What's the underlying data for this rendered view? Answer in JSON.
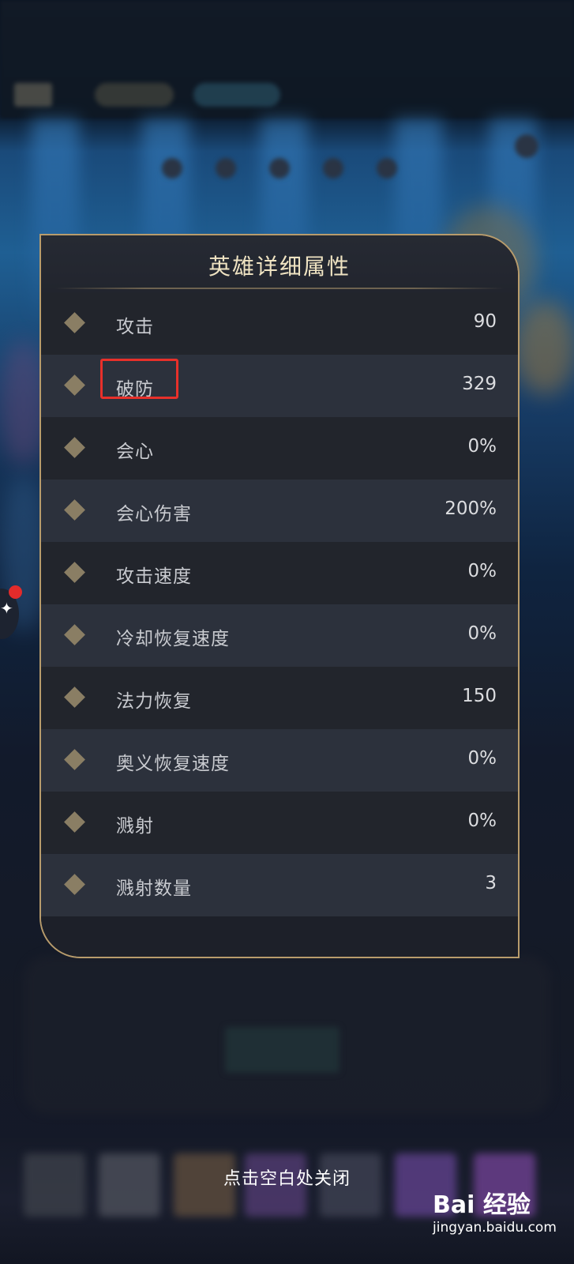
{
  "modal": {
    "title": "英雄详细属性",
    "rows": [
      {
        "label": "攻击",
        "value": "90"
      },
      {
        "label": "破防",
        "value": "329"
      },
      {
        "label": "会心",
        "value": "0%"
      },
      {
        "label": "会心伤害",
        "value": "200%"
      },
      {
        "label": "攻击速度",
        "value": "0%"
      },
      {
        "label": "冷却恢复速度",
        "value": "0%"
      },
      {
        "label": "法力恢复",
        "value": "150"
      },
      {
        "label": "奥义恢复速度",
        "value": "0%"
      },
      {
        "label": "溅射",
        "value": "0%"
      },
      {
        "label": "溅射数量",
        "value": "3"
      }
    ],
    "highlighted_row_label": "破防"
  },
  "footer": {
    "close_hint": "点击空白处关闭"
  },
  "watermark": {
    "logo_text": "Bai 经验",
    "url": "jingyan.baidu.com"
  },
  "colors": {
    "panel_border": "#b89c6c",
    "title_text": "#efe3c2",
    "highlight_box": "#e8302a",
    "notification_dot": "#e22b2b"
  }
}
